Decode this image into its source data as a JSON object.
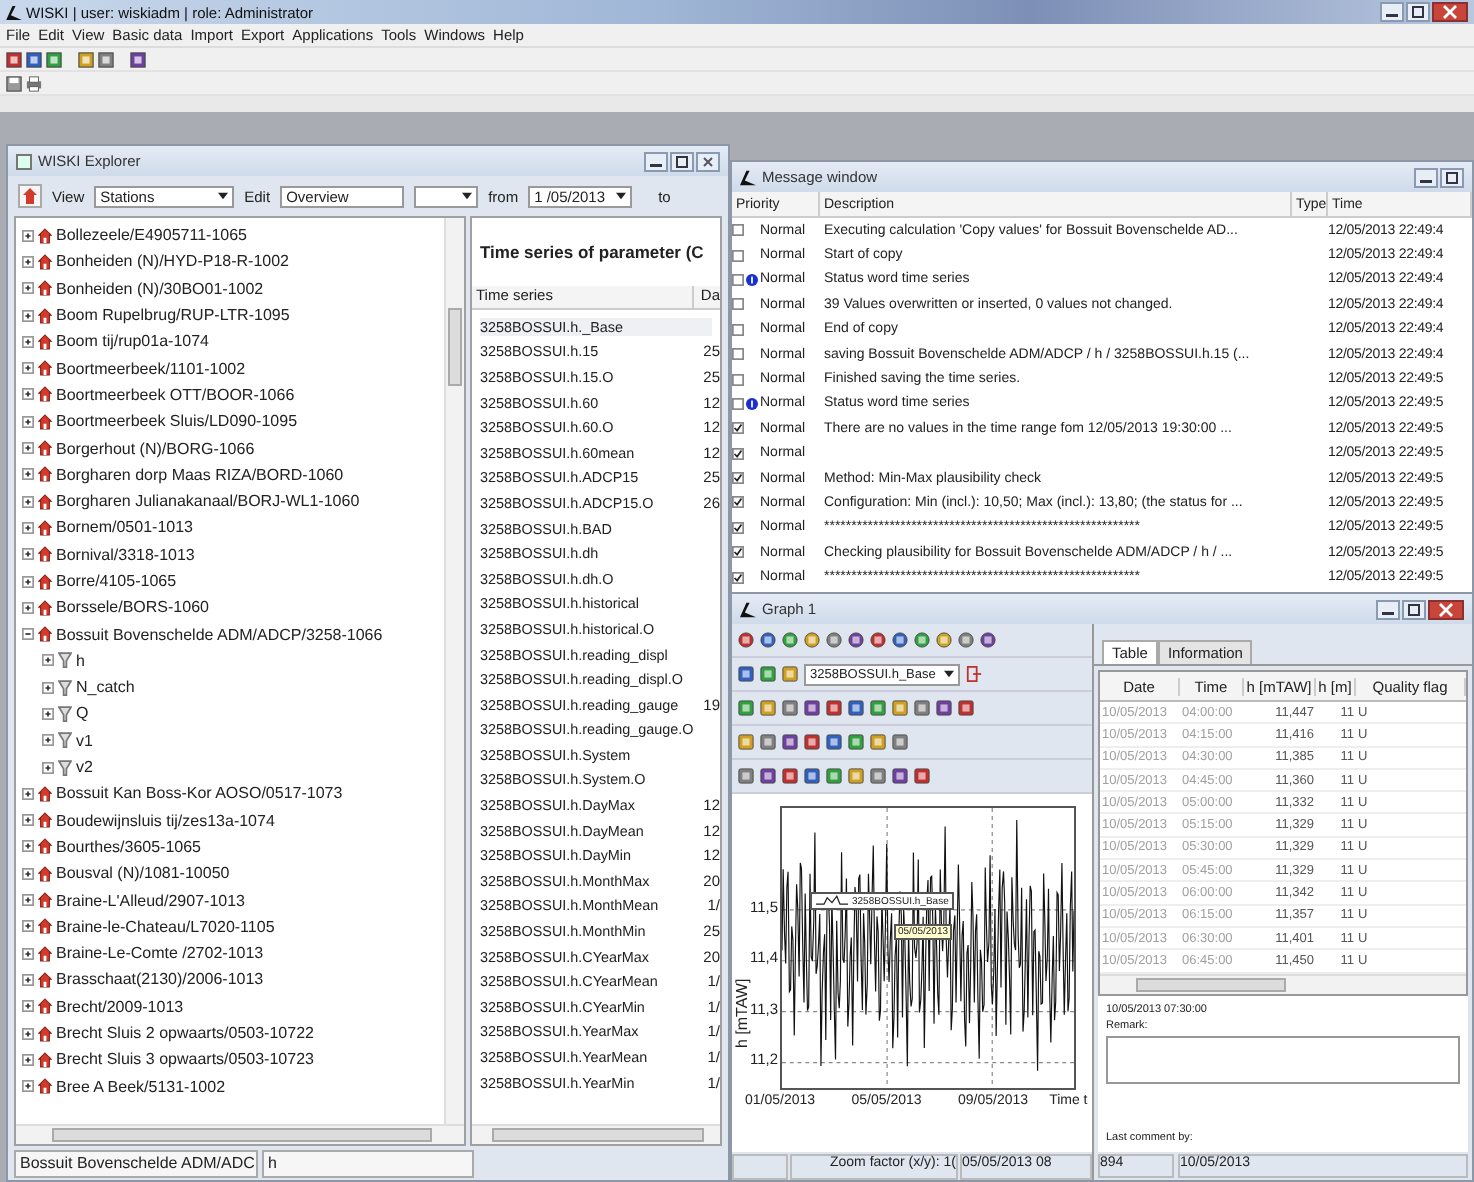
{
  "window": {
    "title": "WISKI | user: wiskiadm | role: Administrator"
  },
  "menu": [
    "File",
    "Edit",
    "View",
    "Basic data",
    "Import",
    "Export",
    "Applications",
    "Tools",
    "Windows",
    "Help"
  ],
  "explorer": {
    "title": "WISKI Explorer",
    "toolbar": {
      "view_label": "View",
      "view_select": "Stations",
      "edit_label": "Edit",
      "edit_select": "Overview",
      "from_label": "from",
      "from_date": "1 /05/2013",
      "to_label": "to"
    },
    "tree": [
      {
        "label": "Bollezeele/E4905711-1065",
        "expanded": false
      },
      {
        "label": "Bonheiden (N)/HYD-P18-R-1002",
        "expanded": false
      },
      {
        "label": "Bonheiden (N)/30BO01-1002",
        "expanded": false
      },
      {
        "label": "Boom Rupelbrug/RUP-LTR-1095",
        "expanded": false
      },
      {
        "label": "Boom tij/rup01a-1074",
        "expanded": false
      },
      {
        "label": "Boortmeerbeek/1101-1002",
        "expanded": false
      },
      {
        "label": "Boortmeerbeek OTT/BOOR-1066",
        "expanded": false
      },
      {
        "label": "Boortmeerbeek Sluis/LD090-1095",
        "expanded": false
      },
      {
        "label": "Borgerhout (N)/BORG-1066",
        "expanded": false
      },
      {
        "label": "Borgharen dorp Maas RIZA/BORD-1060",
        "expanded": false
      },
      {
        "label": "Borgharen Julianakanaal/BORJ-WL1-1060",
        "expanded": false
      },
      {
        "label": "Bornem/0501-1013",
        "expanded": false
      },
      {
        "label": "Bornival/3318-1013",
        "expanded": false
      },
      {
        "label": "Borre/4105-1065",
        "expanded": false
      },
      {
        "label": "Borssele/BORS-1060",
        "expanded": false
      },
      {
        "label": "Bossuit Bovenschelde ADM/ADCP/3258-1066",
        "expanded": true,
        "children": [
          {
            "label": "h",
            "expanded": false
          },
          {
            "label": "N_catch",
            "expanded": false
          },
          {
            "label": "Q",
            "expanded": false
          },
          {
            "label": "v1",
            "expanded": false
          },
          {
            "label": "v2",
            "expanded": false
          }
        ]
      },
      {
        "label": "Bossuit Kan Boss-Kor AOSO/0517-1073",
        "expanded": false
      },
      {
        "label": "Boudewijnsluis tij/zes13a-1074",
        "expanded": false
      },
      {
        "label": "Bourthes/3605-1065",
        "expanded": false
      },
      {
        "label": "Bousval (N)/1081-10050",
        "expanded": false
      },
      {
        "label": "Braine-L'Alleud/2907-1013",
        "expanded": false
      },
      {
        "label": "Braine-le-Chateau/L7020-1105",
        "expanded": false
      },
      {
        "label": "Braine-Le-Comte /2702-1013",
        "expanded": false
      },
      {
        "label": "Brasschaat(2130)/2006-1013",
        "expanded": false
      },
      {
        "label": "Brecht/2009-1013",
        "expanded": false
      },
      {
        "label": "Brecht Sluis 2 opwaarts/0503-10722",
        "expanded": false
      },
      {
        "label": "Brecht Sluis 3 opwaarts/0503-10723",
        "expanded": false
      },
      {
        "label": "Bree A Beek/5131-1002",
        "expanded": false
      }
    ],
    "heading": "Time series of parameter (C",
    "columns": [
      "Time series",
      "Da"
    ],
    "rows": [
      {
        "name": "3258BOSSUI.h._Base",
        "selected": true
      },
      {
        "name": "3258BOSSUI.h.15",
        "column_2": "25",
        "selected": false
      },
      {
        "name": "3258BOSSUI.h.15.O",
        "column_2": "25",
        "selected": false
      },
      {
        "name": "3258BOSSUI.h.60",
        "column_2": "12",
        "selected": false
      },
      {
        "name": "3258BOSSUI.h.60.O",
        "column_2": "12",
        "selected": false
      },
      {
        "name": "3258BOSSUI.h.60mean",
        "column_2": "12",
        "selected": false
      },
      {
        "name": "3258BOSSUI.h.ADCP15",
        "column_2": "25",
        "selected": false
      },
      {
        "name": "3258BOSSUI.h.ADCP15.O",
        "column_2": "26",
        "selected": false
      },
      {
        "name": "3258BOSSUI.h.BAD",
        "selected": false
      },
      {
        "name": "3258BOSSUI.h.dh",
        "selected": false
      },
      {
        "name": "3258BOSSUI.h.dh.O",
        "selected": false
      },
      {
        "name": "3258BOSSUI.h.historical",
        "selected": false
      },
      {
        "name": "3258BOSSUI.h.historical.O",
        "selected": false
      },
      {
        "name": "3258BOSSUI.h.reading_displ",
        "selected": false
      },
      {
        "name": "3258BOSSUI.h.reading_displ.O",
        "selected": false
      },
      {
        "name": "3258BOSSUI.h.reading_gauge",
        "column_2": "19",
        "selected": false
      },
      {
        "name": "3258BOSSUI.h.reading_gauge.O",
        "selected": false
      },
      {
        "name": "3258BOSSUI.h.System",
        "selected": false
      },
      {
        "name": "3258BOSSUI.h.System.O",
        "selected": false
      },
      {
        "name": "3258BOSSUI.h.DayMax",
        "column_2": "12",
        "selected": false
      },
      {
        "name": "3258BOSSUI.h.DayMean",
        "column_2": "12",
        "selected": false
      },
      {
        "name": "3258BOSSUI.h.DayMin",
        "column_2": "12",
        "selected": false
      },
      {
        "name": "3258BOSSUI.h.MonthMax",
        "column_2": "20",
        "selected": false
      },
      {
        "name": "3258BOSSUI.h.MonthMean",
        "column_2": "1/",
        "selected": false
      },
      {
        "name": "3258BOSSUI.h.MonthMin",
        "column_2": "25",
        "selected": false
      },
      {
        "name": "3258BOSSUI.h.CYearMax",
        "column_2": "20",
        "selected": false
      },
      {
        "name": "3258BOSSUI.h.CYearMean",
        "column_2": "1/",
        "selected": false
      },
      {
        "name": "3258BOSSUI.h.CYearMin",
        "column_2": "1/",
        "selected": false
      },
      {
        "name": "3258BOSSUI.h.YearMax",
        "column_2": "1/",
        "selected": false
      },
      {
        "name": "3258BOSSUI.h.YearMean",
        "column_2": "1/",
        "selected": false
      },
      {
        "name": "3258BOSSUI.h.YearMin",
        "column_2": "1/",
        "selected": false
      }
    ],
    "status": [
      "Bossuit Bovenschelde ADM/ADC",
      "h"
    ]
  },
  "messages": {
    "title": "Message window",
    "columns": [
      "Priority",
      "Description",
      "Type",
      "Time"
    ],
    "rows": [
      {
        "checked": false,
        "info": false,
        "priority": "Normal",
        "description": "Executing calculation 'Copy values'  for Bossuit Bovenschelde AD...",
        "time": "12/05/2013 22:49:4"
      },
      {
        "checked": false,
        "info": false,
        "priority": "Normal",
        "description": "Start of copy",
        "time": "12/05/2013 22:49:4"
      },
      {
        "checked": false,
        "info": true,
        "priority": "Normal",
        "description": "Status word time series",
        "time": "12/05/2013 22:49:4"
      },
      {
        "checked": false,
        "info": false,
        "priority": "Normal",
        "description": "39 Values overwritten or inserted, 0 values not changed.",
        "time": "12/05/2013 22:49:4"
      },
      {
        "checked": false,
        "info": false,
        "priority": "Normal",
        "description": "End of copy",
        "time": "12/05/2013 22:49:4"
      },
      {
        "checked": false,
        "info": false,
        "priority": "Normal",
        "description": "saving Bossuit Bovenschelde ADM/ADCP / h / 3258BOSSUI.h.15 (...",
        "time": "12/05/2013 22:49:4"
      },
      {
        "checked": false,
        "info": false,
        "priority": "Normal",
        "description": "Finished saving the time series.",
        "time": "12/05/2013 22:49:5"
      },
      {
        "checked": false,
        "info": true,
        "priority": "Normal",
        "description": "Status word time series",
        "time": "12/05/2013 22:49:5"
      },
      {
        "checked": true,
        "info": false,
        "priority": "Normal",
        "description": "There are no values in the time range fom  12/05/2013 19:30:00  ...",
        "time": "12/05/2013 22:49:5"
      },
      {
        "checked": true,
        "info": false,
        "priority": "Normal",
        "time": "12/05/2013 22:49:5"
      },
      {
        "checked": true,
        "info": false,
        "priority": "Normal",
        "description": "Method: Min-Max plausibility check",
        "time": "12/05/2013 22:49:5"
      },
      {
        "checked": true,
        "info": false,
        "priority": "Normal",
        "description": "Configuration: Min (incl.): 10,50; Max (incl.): 13,80;  (the status for ...",
        "time": "12/05/2013 22:49:5"
      },
      {
        "checked": true,
        "info": false,
        "priority": "Normal",
        "description": "**********************************************************",
        "time": "12/05/2013 22:49:5"
      },
      {
        "checked": true,
        "info": false,
        "priority": "Normal",
        "description": "Checking plausibility for Bossuit Bovenschelde ADM/ADCP / h / ...",
        "time": "12/05/2013 22:49:5"
      },
      {
        "checked": true,
        "info": false,
        "priority": "Normal",
        "description": "**********************************************************",
        "time": "12/05/2013 22:49:5"
      }
    ]
  },
  "graph": {
    "title": "Graph 1",
    "series_select": "3258BOSSUI.h_Base",
    "plot": {
      "ylabel": "h [mTAW]",
      "yticks": [
        "11,5",
        "11,4",
        "11,3",
        "11,2"
      ],
      "xticks": [
        "01/05/2013",
        "05/05/2013",
        "09/05/2013",
        "Time t"
      ],
      "legend": "3258BOSSUI.h_Base",
      "tooltip": "05/05/2013"
    },
    "status": [
      "Zoom factor (x/y):  1(",
      "05/05/2013 08"
    ],
    "tabs": [
      {
        "label": "Table",
        "selected": true
      },
      {
        "label": "Information",
        "selected": false
      }
    ],
    "table": {
      "columns": [
        "Date",
        "Time",
        "h [mTAW]",
        "h [m]",
        "Quality flag"
      ],
      "rows": [
        [
          "10/05/2013",
          "04:00:00",
          "11,447",
          "11",
          "U"
        ],
        [
          "10/05/2013",
          "04:15:00",
          "11,416",
          "11",
          "U"
        ],
        [
          "10/05/2013",
          "04:30:00",
          "11,385",
          "11",
          "U"
        ],
        [
          "10/05/2013",
          "04:45:00",
          "11,360",
          "11",
          "U"
        ],
        [
          "10/05/2013",
          "05:00:00",
          "11,332",
          "11",
          "U"
        ],
        [
          "10/05/2013",
          "05:15:00",
          "11,329",
          "11",
          "U"
        ],
        [
          "10/05/2013",
          "05:30:00",
          "11,329",
          "11",
          "U"
        ],
        [
          "10/05/2013",
          "05:45:00",
          "11,329",
          "11",
          "U"
        ],
        [
          "10/05/2013",
          "06:00:00",
          "11,342",
          "11",
          "U"
        ],
        [
          "10/05/2013",
          "06:15:00",
          "11,357",
          "11",
          "U"
        ],
        [
          "10/05/2013",
          "06:30:00",
          "11,401",
          "11",
          "U"
        ],
        [
          "10/05/2013",
          "06:45:00",
          "11,450",
          "11",
          "U"
        ]
      ]
    },
    "selected_time": "10/05/2013 07:30:00",
    "remark_label": "Remark:",
    "last_comment_label": "Last comment by:",
    "footer": [
      "894",
      "10/05/2013"
    ]
  }
}
